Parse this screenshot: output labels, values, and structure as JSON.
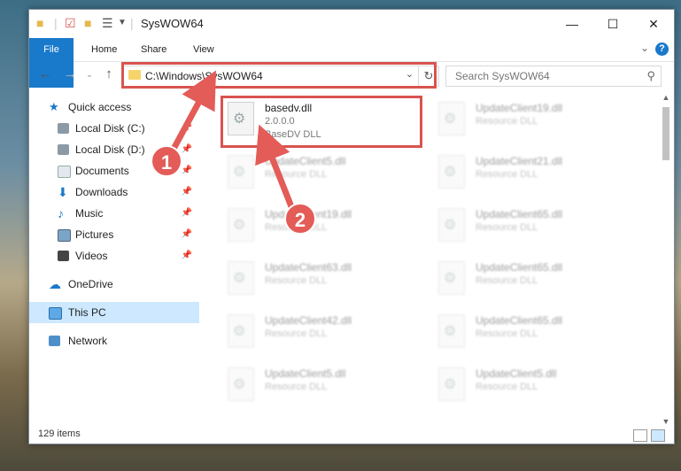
{
  "window": {
    "title": "SysWOW64",
    "quick_access_toolbar": [
      "folder-icon",
      "properties-icon",
      "new-folder-icon",
      "customize-icon"
    ],
    "controls": {
      "minimize": "—",
      "maximize": "☐",
      "close": "✕"
    }
  },
  "ribbon": {
    "tabs": [
      "File",
      "Home",
      "Share",
      "View"
    ],
    "help": "?"
  },
  "address_bar": {
    "path": "C:\\Windows\\SysWOW64",
    "search_placeholder": "Search SysWOW64"
  },
  "nav_pane": {
    "items": [
      {
        "label": "Quick access",
        "icon": "star-icon",
        "pinned": false
      },
      {
        "label": "Local Disk (C:)",
        "icon": "drive-icon",
        "pinned": true
      },
      {
        "label": "Local Disk (D:)",
        "icon": "drive-icon",
        "pinned": true
      },
      {
        "label": "Documents",
        "icon": "documents-icon",
        "pinned": true
      },
      {
        "label": "Downloads",
        "icon": "downloads-icon",
        "pinned": true
      },
      {
        "label": "Music",
        "icon": "music-icon",
        "pinned": true
      },
      {
        "label": "Pictures",
        "icon": "pictures-icon",
        "pinned": true
      },
      {
        "label": "Videos",
        "icon": "videos-icon",
        "pinned": true
      },
      {
        "label": "OneDrive",
        "icon": "cloud-icon",
        "pinned": false
      },
      {
        "label": "This PC",
        "icon": "computer-icon",
        "pinned": false,
        "selected": true
      },
      {
        "label": "Network",
        "icon": "network-icon",
        "pinned": false
      }
    ],
    "pin_glyph": "📌"
  },
  "files": [
    {
      "name": "basedv.dll",
      "version": "2.0.0.0",
      "description": "BaseDV DLL",
      "highlighted": true
    },
    {
      "name": "UpdateClient19.dll",
      "version": "",
      "description": "Resource DLL",
      "highlighted": false
    },
    {
      "name": "UpdateClient5.dll",
      "version": "",
      "description": "Resource DLL",
      "highlighted": false
    },
    {
      "name": "UpdateClient21.dll",
      "version": "",
      "description": "Resource DLL",
      "highlighted": false
    },
    {
      "name": "UpdateClient19.dll",
      "version": "",
      "description": "Resource DLL",
      "highlighted": false
    },
    {
      "name": "UpdateClient65.dll",
      "version": "",
      "description": "Resource DLL",
      "highlighted": false
    },
    {
      "name": "UpdateClient63.dll",
      "version": "",
      "description": "Resource DLL",
      "highlighted": false
    },
    {
      "name": "UpdateClient65.dll",
      "version": "",
      "description": "Resource DLL",
      "highlighted": false
    },
    {
      "name": "UpdateClient42.dll",
      "version": "",
      "description": "Resource DLL",
      "highlighted": false
    },
    {
      "name": "UpdateClient65.dll",
      "version": "",
      "description": "Resource DLL",
      "highlighted": false
    },
    {
      "name": "UpdateClient5.dll",
      "version": "",
      "description": "Resource DLL",
      "highlighted": false
    },
    {
      "name": "UpdateClient5.dll",
      "version": "",
      "description": "Resource DLL",
      "highlighted": false
    }
  ],
  "status_bar": {
    "item_count": "129 items"
  },
  "annotations": {
    "marker_1": "1",
    "marker_2": "2",
    "color": "#e35c58"
  },
  "colors": {
    "accent": "#1979ca",
    "selection": "#cde8ff"
  }
}
